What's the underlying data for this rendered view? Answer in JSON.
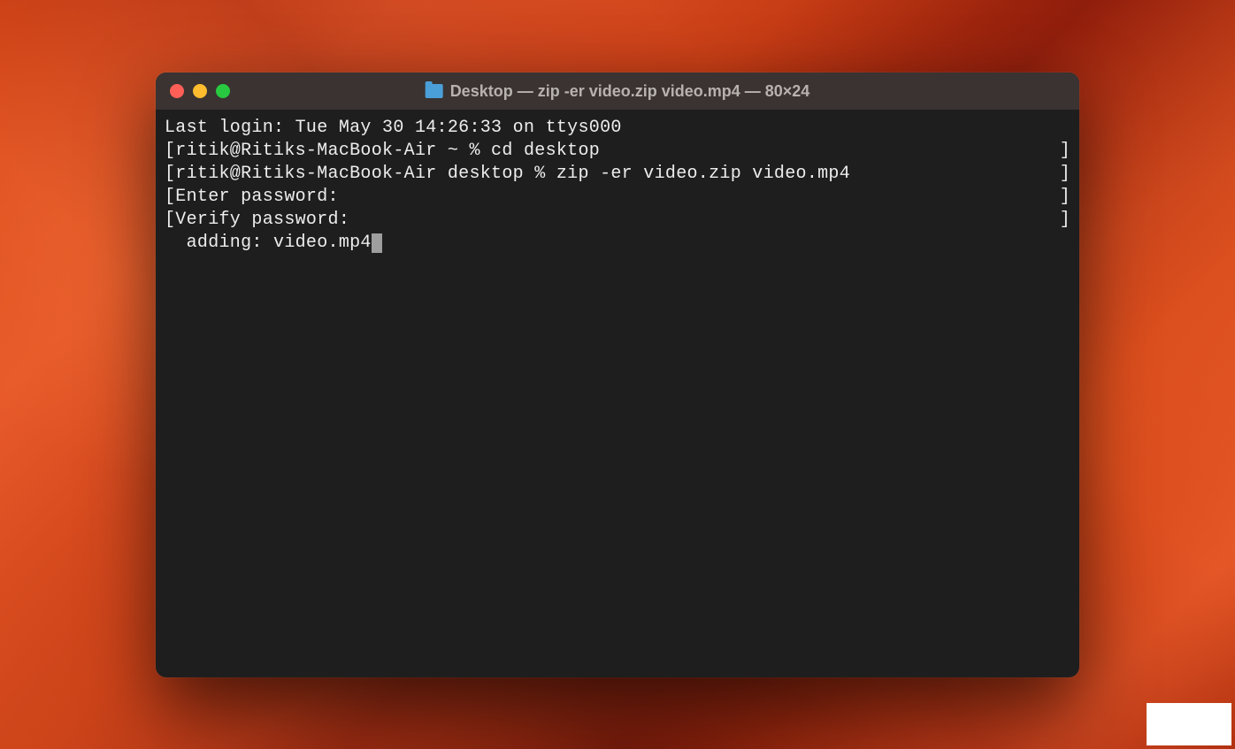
{
  "window": {
    "title": "Desktop — zip -er video.zip video.mp4 — 80×24"
  },
  "terminal": {
    "lines": [
      {
        "content": "Last login: Tue May 30 14:26:33 on ttys000",
        "end": ""
      },
      {
        "content": "[ritik@Ritiks-MacBook-Air ~ % cd desktop",
        "end": "]"
      },
      {
        "content": "[ritik@Ritiks-MacBook-Air desktop % zip -er video.zip video.mp4",
        "end": "]"
      },
      {
        "content": "[Enter password:",
        "end": "]"
      },
      {
        "content": "[Verify password:",
        "end": "]"
      },
      {
        "content": "  adding: video.mp4",
        "end": "",
        "cursor": true
      }
    ]
  }
}
